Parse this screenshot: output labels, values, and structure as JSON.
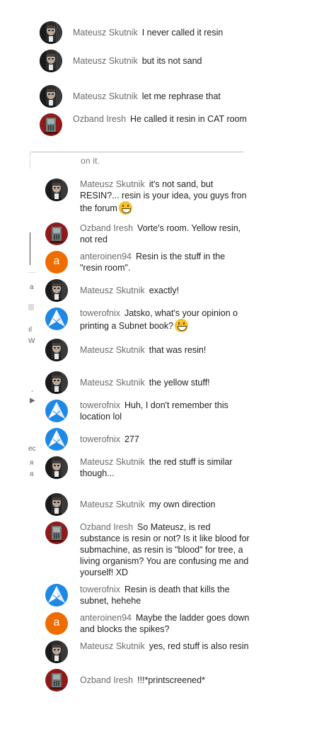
{
  "top_messages": [
    {
      "author": "Mateusz Skutnik",
      "avatar": "mateusz",
      "text": "I never called it resin"
    },
    {
      "author": "Mateusz Skutnik",
      "avatar": "mateusz",
      "text": "but its not sand"
    },
    {
      "author": "Mateusz Skutnik",
      "avatar": "mateusz",
      "text": "let me rephrase that"
    },
    {
      "author": "Ozband Iresh",
      "avatar": "ozband",
      "text": "He called it resin in CAT room"
    }
  ],
  "cut_fragment": "on it.",
  "messages": [
    {
      "author": "Mateusz Skutnik",
      "avatar": "mateusz",
      "text": "it's not sand, but RESIN?... resin is your idea, you guys fron the forum",
      "emoji": "grinning-face"
    },
    {
      "author": "Ozband Iresh",
      "avatar": "ozband",
      "text": "Vorte's room. Yellow resin, not red"
    },
    {
      "author": "anteroinen94",
      "avatar": "letter-a",
      "avatar_letter": "a",
      "text": "Resin is the stuff in the \"resin room\"."
    },
    {
      "author": "Mateusz Skutnik",
      "avatar": "mateusz",
      "text": "exactly!"
    },
    {
      "author": "towerofnix",
      "avatar": "tower",
      "text": "Jatsko, what's your opinion o printing a Subnet book?",
      "emoji": "grinning-face"
    },
    {
      "author": "Mateusz Skutnik",
      "avatar": "mateusz",
      "text": "that was resin!"
    },
    {
      "author": "Mateusz Skutnik",
      "avatar": "mateusz",
      "text": "the yellow stuff!"
    },
    {
      "author": "towerofnix",
      "avatar": "tower",
      "text": "Huh, I don't remember this location lol"
    },
    {
      "author": "towerofnix",
      "avatar": "tower",
      "text": "277"
    },
    {
      "author": "Mateusz Skutnik",
      "avatar": "mateusz",
      "text": "the red stuff is similar though..."
    },
    {
      "author": "Mateusz Skutnik",
      "avatar": "mateusz",
      "text": "my own direction"
    },
    {
      "author": "Ozband Iresh",
      "avatar": "ozband",
      "text": "So Mateusz, is red substance is resin or not? Is it like blood for submachine, as resin is \"blood\" for tree, a living organism? You are confusing me and yourself! XD"
    },
    {
      "author": "towerofnix",
      "avatar": "tower",
      "text": "Resin is death that kills the subnet, hehehe"
    },
    {
      "author": "anteroinen94",
      "avatar": "letter-a",
      "avatar_letter": "a",
      "text": "Maybe the ladder goes down and blocks the spikes?"
    },
    {
      "author": "Mateusz Skutnik",
      "avatar": "mateusz",
      "text": "yes, red stuff is also resin"
    },
    {
      "author": "Ozband Iresh",
      "avatar": "ozband",
      "text": "!!!*printscreened*"
    }
  ],
  "left_fragments": [
    "a",
    "ıl",
    "W",
    "¸",
    "▶",
    "ec",
    "я",
    "я"
  ],
  "colors": {
    "orange_avatar": "#ef6c00",
    "tower_blue": "#1e88e5",
    "ozband_red": "#8e1b1b",
    "author_gray": "#6b6b6b"
  }
}
